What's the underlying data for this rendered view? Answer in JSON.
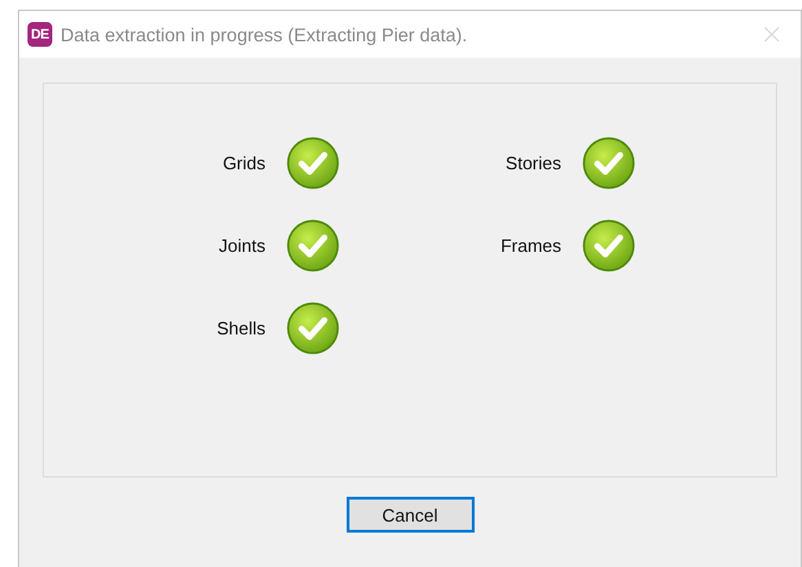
{
  "window": {
    "app_icon": "DE",
    "title": "Data extraction in progress (Extracting Pier data).",
    "close_button": {
      "disabled": true
    }
  },
  "items": [
    {
      "label": "Grids",
      "done": true
    },
    {
      "label": "Stories",
      "done": true
    },
    {
      "label": "Joints",
      "done": true
    },
    {
      "label": "Frames",
      "done": true
    },
    {
      "label": "Shells",
      "done": true
    }
  ],
  "buttons": [
    {
      "label": "Cancel",
      "focused": true
    }
  ]
}
